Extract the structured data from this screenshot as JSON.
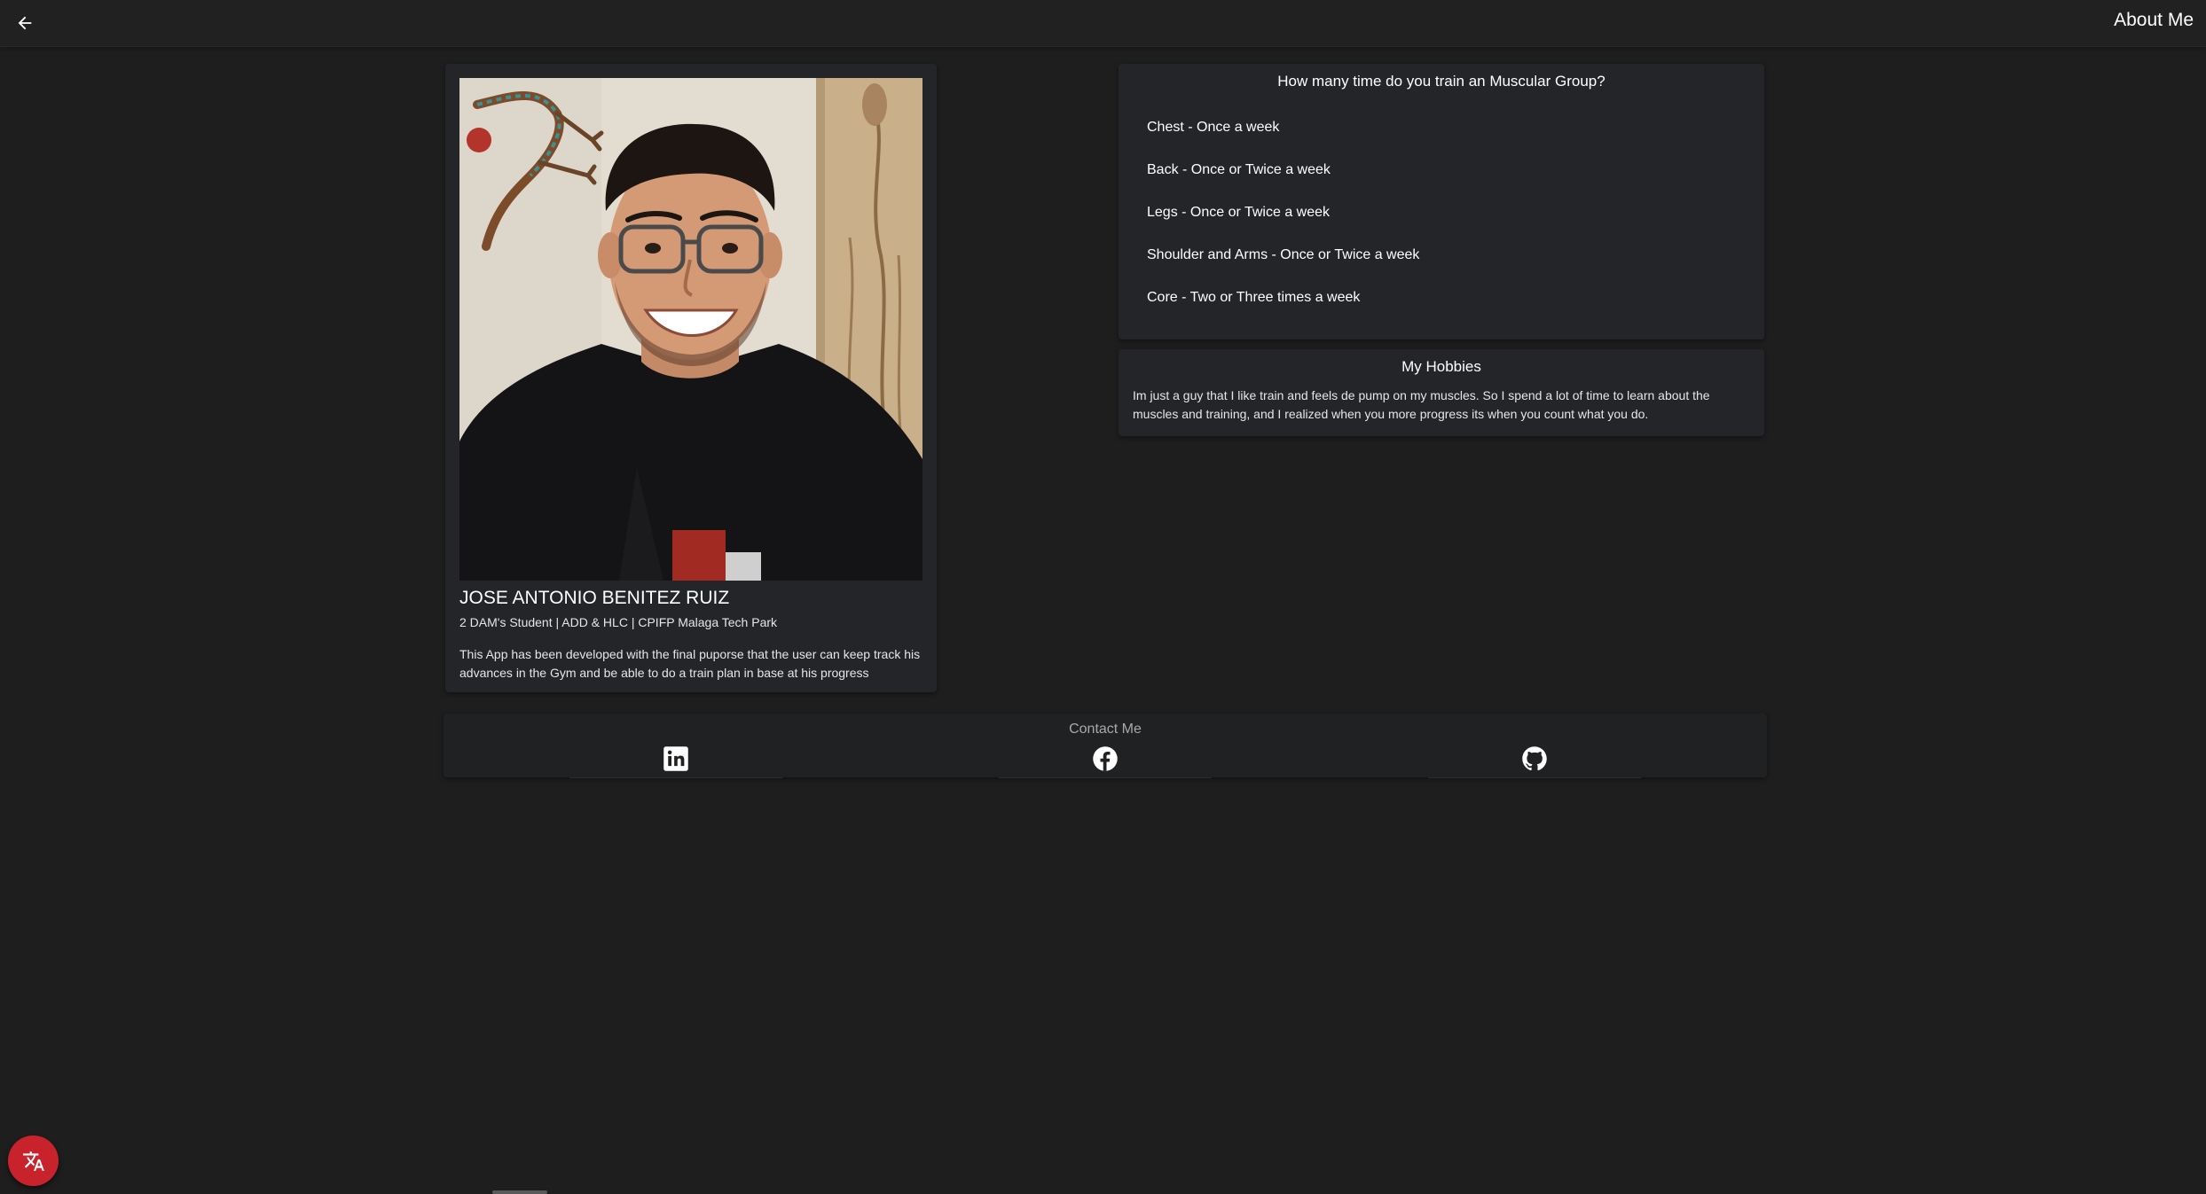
{
  "header": {
    "title": "About Me",
    "back_icon": "arrow-left-icon"
  },
  "profile": {
    "name": "JOSE ANTONIO BENITEZ RUIZ",
    "subtitle": "2 DAM's Student | ADD & HLC | CPIFP Malaga Tech Park",
    "description": "This App has been developed with the final puporse that the user can keep track his advances in the Gym and be able to do a train plan in base at his progress"
  },
  "training": {
    "title": "How many time do you train an Muscular Group?",
    "items": [
      "Chest - Once a week",
      "Back - Once or Twice a week",
      "Legs - Once or Twice a week",
      "Shoulder and Arms - Once or Twice a week",
      "Core - Two or Three times a week"
    ]
  },
  "hobbies": {
    "title": "My Hobbies",
    "text": "Im just a guy that I like train and feels de pump on my muscles. So I spend a lot of time to learn about the muscles and training, and I realized when you more progress its when you count what you do."
  },
  "contact": {
    "title": "Contact Me",
    "links": [
      {
        "icon": "linkedin-icon"
      },
      {
        "icon": "facebook-icon"
      },
      {
        "icon": "github-icon"
      }
    ]
  },
  "fab": {
    "icon": "translate-icon",
    "color": "#c8232d"
  },
  "colors": {
    "background": "#1e1e1f",
    "card": "#232528",
    "accent": "#c8232d"
  }
}
